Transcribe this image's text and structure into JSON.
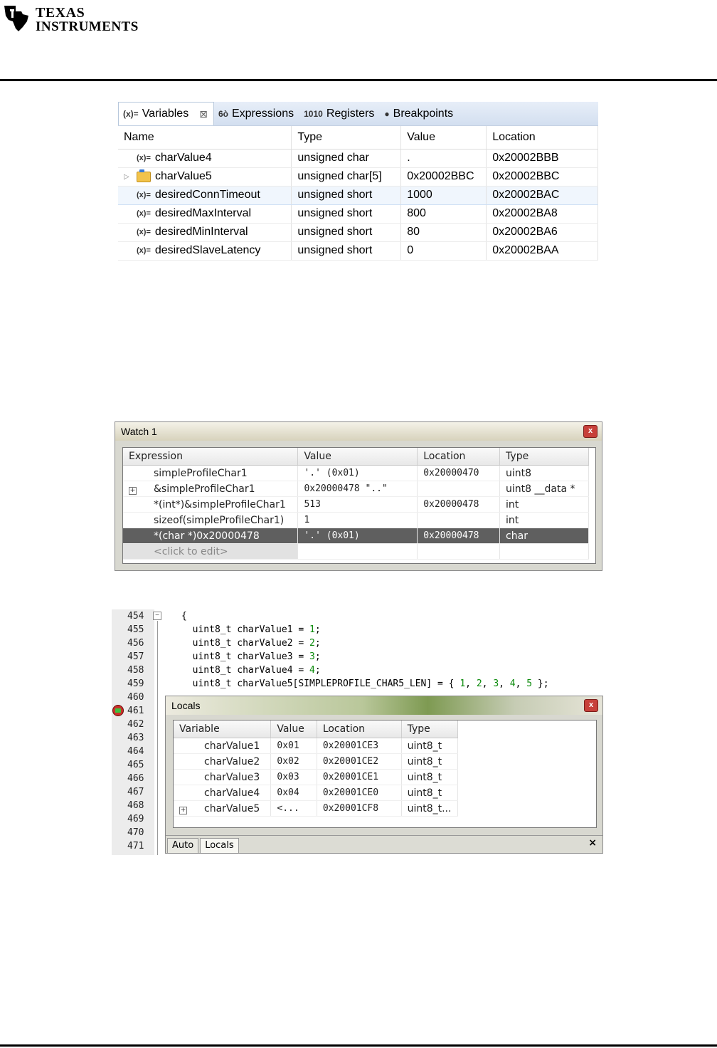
{
  "header": {
    "logo_text_line1": "Texas",
    "logo_text_line2": "Instruments"
  },
  "eclipse_view": {
    "tabs": [
      {
        "icon": "(x)=",
        "label": "Variables"
      },
      {
        "icon": "6ò",
        "label": "Expressions"
      },
      {
        "icon": "1010",
        "label": "Registers"
      },
      {
        "icon": "●",
        "label": "Breakpoints"
      }
    ],
    "columns": [
      "Name",
      "Type",
      "Value",
      "Location"
    ],
    "rows": [
      {
        "name": "charValue4",
        "type": "unsigned char",
        "value": ".",
        "location": "0x20002BBB",
        "kind": "variable"
      },
      {
        "name": "charValue5",
        "type": "unsigned char[5]",
        "value": "0x20002BBC",
        "location": "0x20002BBC",
        "kind": "array"
      },
      {
        "name": "desiredConnTimeout",
        "type": "unsigned short",
        "value": "1000",
        "location": "0x20002BAC",
        "kind": "variable"
      },
      {
        "name": "desiredMaxInterval",
        "type": "unsigned short",
        "value": "800",
        "location": "0x20002BA8",
        "kind": "variable"
      },
      {
        "name": "desiredMinInterval",
        "type": "unsigned short",
        "value": "80",
        "location": "0x20002BA6",
        "kind": "variable"
      },
      {
        "name": "desiredSlaveLatency",
        "type": "unsigned short",
        "value": "0",
        "location": "0x20002BAA",
        "kind": "variable"
      }
    ],
    "selected_row": 2,
    "var_icon": "(x)="
  },
  "watch": {
    "title": "Watch 1",
    "close": "x",
    "columns": [
      "Expression",
      "Value",
      "Location",
      "Type"
    ],
    "rows": [
      {
        "expr": "simpleProfileChar1",
        "value": "'.' (0x01)",
        "location": "0x20000470",
        "type": "uint8",
        "expandable": false
      },
      {
        "expr": "&simpleProfileChar1",
        "value": "0x20000478 \"..\"",
        "location": "",
        "type": "uint8 __data *",
        "expandable": true
      },
      {
        "expr": "*(int*)&simpleProfileChar1",
        "value": "513",
        "location": "0x20000478",
        "type": "int",
        "expandable": false
      },
      {
        "expr": "sizeof(simpleProfileChar1)",
        "value": "1",
        "location": "",
        "type": "int",
        "expandable": false
      },
      {
        "expr": "*(char *)0x20000478",
        "value": "'.' (0x01)",
        "location": "0x20000478",
        "type": "char",
        "expandable": false
      }
    ],
    "highlighted_row": 4,
    "edit_placeholder": "<click to edit>"
  },
  "code": {
    "line_numbers": [
      "454",
      "455",
      "456",
      "457",
      "458",
      "459",
      "460",
      "461",
      "462",
      "463",
      "464",
      "465",
      "466",
      "467",
      "468",
      "469",
      "470",
      "471"
    ],
    "lines": [
      [
        {
          "t": "{",
          "c": ""
        }
      ],
      [
        {
          "t": "  uint8_t charValue1 = ",
          "c": ""
        },
        {
          "t": "1",
          "c": "num"
        },
        {
          "t": ";",
          "c": ""
        }
      ],
      [
        {
          "t": "  uint8_t charValue2 = ",
          "c": ""
        },
        {
          "t": "2",
          "c": "num"
        },
        {
          "t": ";",
          "c": ""
        }
      ],
      [
        {
          "t": "  uint8_t charValue3 = ",
          "c": ""
        },
        {
          "t": "3",
          "c": "num"
        },
        {
          "t": ";",
          "c": ""
        }
      ],
      [
        {
          "t": "  uint8_t charValue4 = ",
          "c": ""
        },
        {
          "t": "4",
          "c": "num"
        },
        {
          "t": ";",
          "c": ""
        }
      ],
      [
        {
          "t": "  uint8_t charValue5[SIMPLEPROFILE_CHAR5_LEN] = { ",
          "c": ""
        },
        {
          "t": "1",
          "c": "num"
        },
        {
          "t": ", ",
          "c": ""
        },
        {
          "t": "2",
          "c": "num"
        },
        {
          "t": ", ",
          "c": ""
        },
        {
          "t": "3",
          "c": "num"
        },
        {
          "t": ", ",
          "c": ""
        },
        {
          "t": "4",
          "c": "num"
        },
        {
          "t": ", ",
          "c": ""
        },
        {
          "t": "5",
          "c": "num"
        },
        {
          "t": " };",
          "c": ""
        }
      ]
    ],
    "fold_symbol": "−"
  },
  "locals": {
    "title": "Locals",
    "close": "x",
    "columns": [
      "Variable",
      "Value",
      "Location",
      "Type"
    ],
    "rows": [
      {
        "name": "charValue1",
        "value": "0x01",
        "location": "0x20001CE3",
        "type": "uint8_t",
        "expandable": false
      },
      {
        "name": "charValue2",
        "value": "0x02",
        "location": "0x20001CE2",
        "type": "uint8_t",
        "expandable": false
      },
      {
        "name": "charValue3",
        "value": "0x03",
        "location": "0x20001CE1",
        "type": "uint8_t",
        "expandable": false
      },
      {
        "name": "charValue4",
        "value": "0x04",
        "location": "0x20001CE0",
        "type": "uint8_t",
        "expandable": false
      },
      {
        "name": "charValue5",
        "value": "<...",
        "location": "0x20001CF8",
        "type": "uint8_t...",
        "expandable": true
      }
    ],
    "tabs": [
      "Auto",
      "Locals"
    ],
    "active_tab": 1,
    "tab_close": "×"
  }
}
